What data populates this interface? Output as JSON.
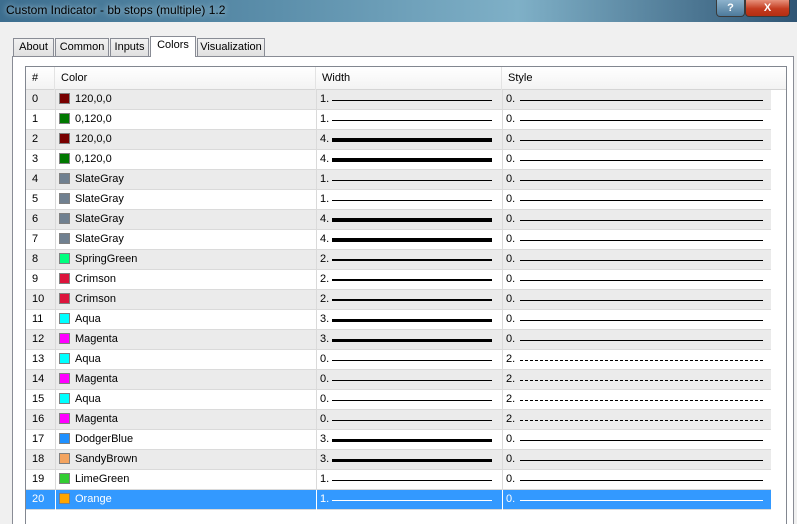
{
  "window": {
    "title": "Custom Indicator - bb stops (multiple) 1.2",
    "help_label": "?",
    "close_label": "X"
  },
  "tabs": [
    {
      "label": "About",
      "active": false
    },
    {
      "label": "Common",
      "active": false
    },
    {
      "label": "Inputs",
      "active": false
    },
    {
      "label": "Colors",
      "active": true
    },
    {
      "label": "Visualization",
      "active": false
    }
  ],
  "table": {
    "headers": {
      "index": "#",
      "color": "Color",
      "width": "Width",
      "style": "Style"
    },
    "selected_row": 20,
    "rows": [
      {
        "index": "0",
        "color_name": "120,0,0",
        "swatch": "#780000",
        "width": "1.",
        "style": "0."
      },
      {
        "index": "1",
        "color_name": "0,120,0",
        "swatch": "#007800",
        "width": "1.",
        "style": "0."
      },
      {
        "index": "2",
        "color_name": "120,0,0",
        "swatch": "#780000",
        "width": "4.",
        "style": "0."
      },
      {
        "index": "3",
        "color_name": "0,120,0",
        "swatch": "#007800",
        "width": "4.",
        "style": "0."
      },
      {
        "index": "4",
        "color_name": "SlateGray",
        "swatch": "#708090",
        "width": "1.",
        "style": "0."
      },
      {
        "index": "5",
        "color_name": "SlateGray",
        "swatch": "#708090",
        "width": "1.",
        "style": "0."
      },
      {
        "index": "6",
        "color_name": "SlateGray",
        "swatch": "#708090",
        "width": "4.",
        "style": "0."
      },
      {
        "index": "7",
        "color_name": "SlateGray",
        "swatch": "#708090",
        "width": "4.",
        "style": "0."
      },
      {
        "index": "8",
        "color_name": "SpringGreen",
        "swatch": "#00ff7f",
        "width": "2.",
        "style": "0."
      },
      {
        "index": "9",
        "color_name": "Crimson",
        "swatch": "#dc143c",
        "width": "2.",
        "style": "0."
      },
      {
        "index": "10",
        "color_name": "Crimson",
        "swatch": "#dc143c",
        "width": "2.",
        "style": "0."
      },
      {
        "index": "11",
        "color_name": "Aqua",
        "swatch": "#00ffff",
        "width": "3.",
        "style": "0."
      },
      {
        "index": "12",
        "color_name": "Magenta",
        "swatch": "#ff00ff",
        "width": "3.",
        "style": "0."
      },
      {
        "index": "13",
        "color_name": "Aqua",
        "swatch": "#00ffff",
        "width": "0.",
        "style": "2."
      },
      {
        "index": "14",
        "color_name": "Magenta",
        "swatch": "#ff00ff",
        "width": "0.",
        "style": "2."
      },
      {
        "index": "15",
        "color_name": "Aqua",
        "swatch": "#00ffff",
        "width": "0.",
        "style": "2."
      },
      {
        "index": "16",
        "color_name": "Magenta",
        "swatch": "#ff00ff",
        "width": "0.",
        "style": "2."
      },
      {
        "index": "17",
        "color_name": "DodgerBlue",
        "swatch": "#1e90ff",
        "width": "3.",
        "style": "0."
      },
      {
        "index": "18",
        "color_name": "SandyBrown",
        "swatch": "#f4a460",
        "width": "3.",
        "style": "0."
      },
      {
        "index": "19",
        "color_name": "LimeGreen",
        "swatch": "#32cd32",
        "width": "1.",
        "style": "0."
      },
      {
        "index": "20",
        "color_name": "Orange",
        "swatch": "#ffa500",
        "width": "1.",
        "style": "0."
      }
    ]
  }
}
